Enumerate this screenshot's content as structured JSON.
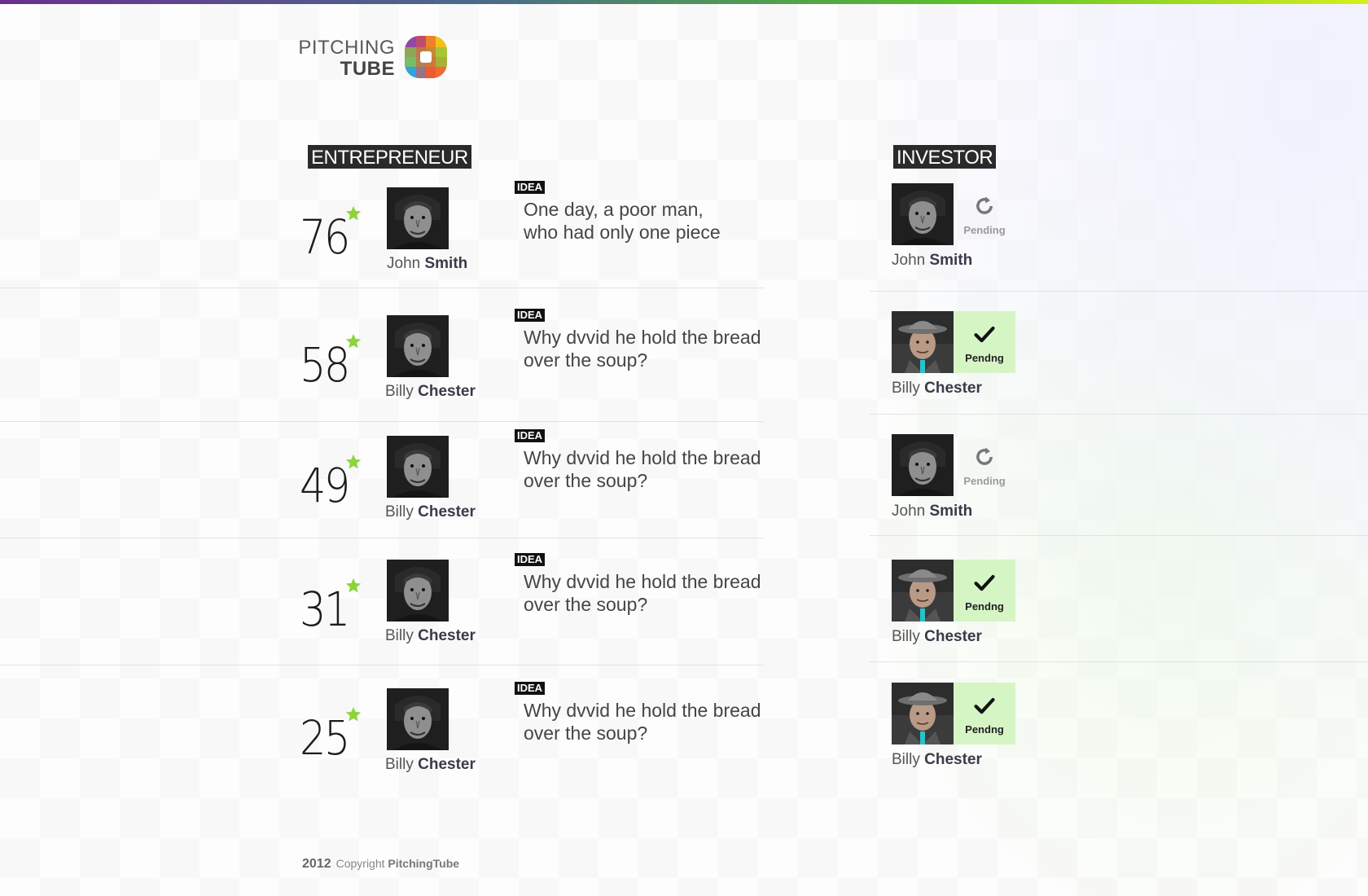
{
  "brand": {
    "line1": "PITCHING",
    "line2": "TUBE",
    "colors": [
      "#f2c21a",
      "#8e4aa6",
      "#2fa3da",
      "#8dc63f",
      "#f26c2d",
      "#e94e3c"
    ]
  },
  "accent_colors": {
    "topbar_start": "#6b2f8f",
    "topbar_end": "#d6ef1c",
    "star": "#8dd43c",
    "approved_bg": "#d6f5c5"
  },
  "entrepreneur": {
    "heading": "ENTREPRENEUR",
    "rows": [
      {
        "score": "76",
        "first": "John",
        "last": "Smith",
        "tag": "IDEA",
        "idea_line1": "One day, a poor man,",
        "idea_line2": "who had only one piece"
      },
      {
        "score": "58",
        "first": "Billy",
        "last": "Chester",
        "tag": "IDEA",
        "idea_line1": "Why dvvid he hold the bread",
        "idea_line2": "over the soup?"
      },
      {
        "score": "49",
        "first": "Billy",
        "last": "Chester",
        "tag": "IDEA",
        "idea_line1": "Why dvvid he hold the bread",
        "idea_line2": "over the soup?"
      },
      {
        "score": "31",
        "first": "Billy",
        "last": "Chester",
        "tag": "IDEA",
        "idea_line1": "Why dvvid he hold the bread",
        "idea_line2": "over the soup?"
      },
      {
        "score": "25",
        "first": "Billy",
        "last": "Chester",
        "tag": "IDEA",
        "idea_line1": "Why dvvid he hold the bread",
        "idea_line2": "over the soup?"
      }
    ]
  },
  "investor": {
    "heading": "INVESTOR",
    "rows": [
      {
        "first": "John",
        "last": "Smith",
        "status": "Pending",
        "icon": "refresh-icon"
      },
      {
        "first": "Billy",
        "last": "Chester",
        "status": "Pendng",
        "icon": "checkmark-icon"
      },
      {
        "first": "John",
        "last": "Smith",
        "status": "Pending",
        "icon": "refresh-icon"
      },
      {
        "first": "Billy",
        "last": "Chester",
        "status": "Pendng",
        "icon": "checkmark-icon"
      },
      {
        "first": "Billy",
        "last": "Chester",
        "status": "Pendng",
        "icon": "checkmark-icon"
      }
    ]
  },
  "footer": {
    "year": "2012",
    "copyright": "Copyright",
    "brand": "PitchingTube"
  }
}
